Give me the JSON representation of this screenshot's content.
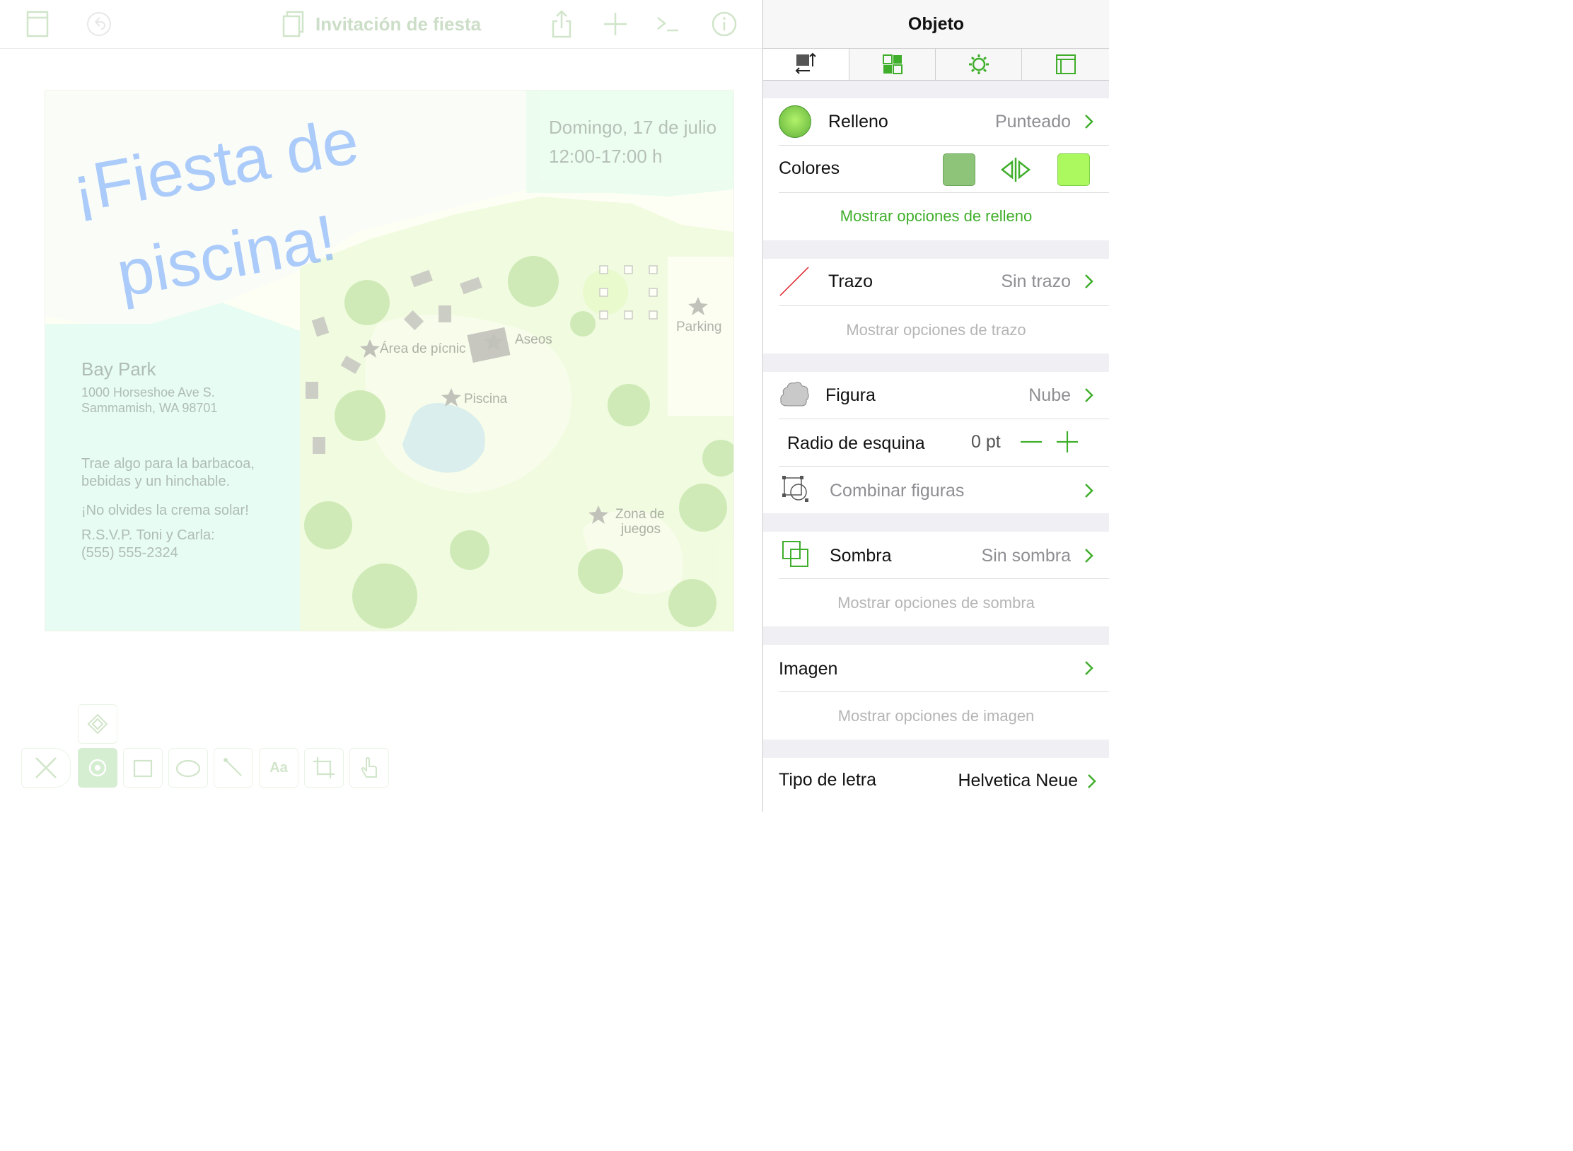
{
  "toolbar": {
    "document_title": "Invitación de fiesta",
    "icons": [
      "sidebar-icon",
      "undo-icon",
      "document-icon",
      "share-icon",
      "add-icon",
      "console-icon",
      "info-icon"
    ]
  },
  "canvas": {
    "headline": "¡Fiesta de piscina!",
    "date": "Domingo, 17 de julio",
    "time": "12:00-17:00 h",
    "venue": "Bay Park",
    "address_line1": "1000 Horseshoe Ave S.",
    "address_line2": "Sammamish, WA 98701",
    "note1_line1": "Trae algo para la barbacoa,",
    "note1_line2": "bebidas y un hinchable.",
    "note2": "¡No olvides la crema solar!",
    "rsvp_line1": "R.S.V.P. Toni y Carla:",
    "rsvp_line2": "(555) 555-2324",
    "map_labels": {
      "picnic": "Área de pícnic",
      "restrooms": "Aseos",
      "pool": "Piscina",
      "parking": "Parking",
      "playground_line1": "Zona de",
      "playground_line2": "juegos"
    }
  },
  "tools": [
    "close-tool-icon",
    "selection-tool-icon",
    "shape-tool-icon",
    "freehand-tool-icon",
    "line-tool-icon",
    "text-tool-icon",
    "crop-tool-icon",
    "touch-tool-icon",
    "diamond-tool-icon"
  ],
  "inspector": {
    "title": "Objeto",
    "tabs": [
      "geometry-tab-icon",
      "style-tab-icon",
      "settings-tab-icon",
      "canvas-tab-icon"
    ],
    "fill": {
      "label": "Relleno",
      "value": "Punteado"
    },
    "colors": {
      "label": "Colores",
      "color1": "#8dc47a",
      "color2": "#abf95f"
    },
    "show_fill_options": "Mostrar opciones de relleno",
    "stroke": {
      "label": "Trazo",
      "value": "Sin trazo"
    },
    "show_stroke_options": "Mostrar opciones de trazo",
    "shape": {
      "label": "Figura",
      "value": "Nube"
    },
    "corner_radius": {
      "label": "Radio de esquina",
      "value": "0 pt"
    },
    "combine": {
      "label": "Combinar figuras"
    },
    "shadow": {
      "label": "Sombra",
      "value": "Sin sombra"
    },
    "show_shadow_options": "Mostrar opciones de sombra",
    "image": {
      "label": "Imagen"
    },
    "show_image_options": "Mostrar opciones de imagen",
    "font": {
      "label": "Tipo de letra",
      "value": "Helvetica Neue"
    }
  },
  "colors": {
    "accent": "#3fae2a",
    "disabled": "#b5b5b5"
  }
}
